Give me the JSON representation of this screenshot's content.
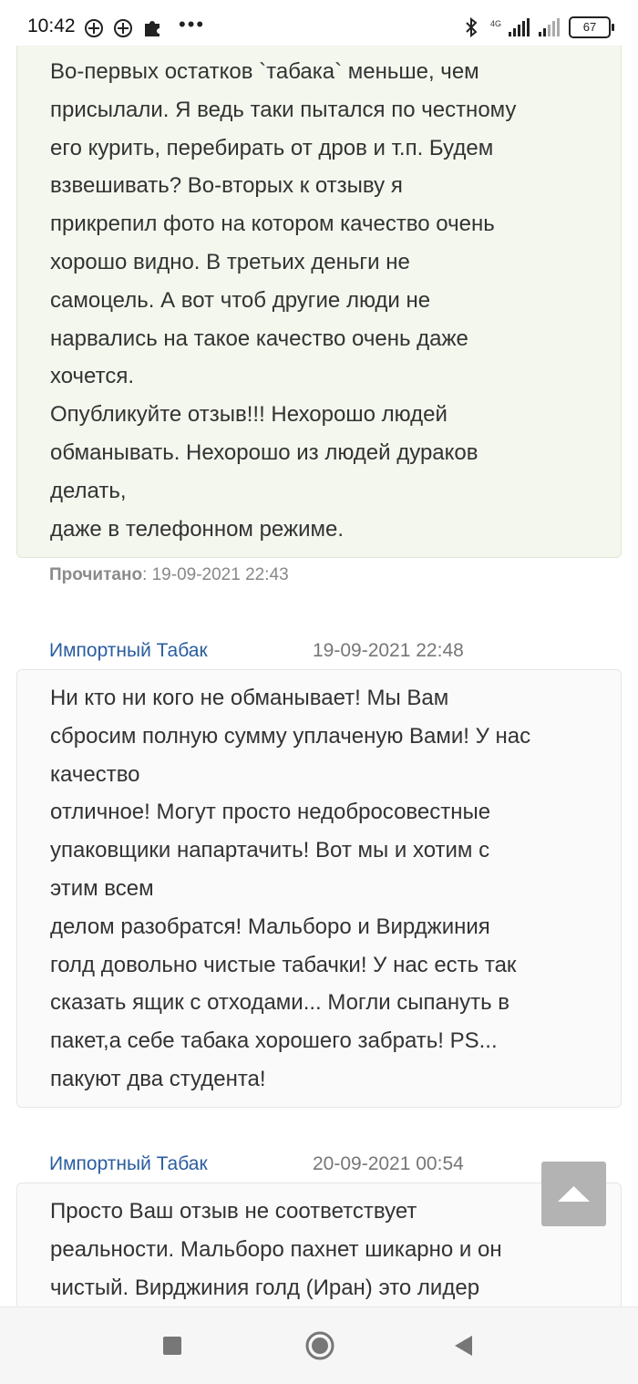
{
  "status_bar": {
    "time": "10:42",
    "network": "4G",
    "battery": "67",
    "icons": [
      "pinwheel-icon",
      "pinwheel-icon",
      "puzzle-icon",
      "more-dots-icon",
      "bluetooth-icon",
      "signal-icon",
      "signal-icon",
      "battery-icon"
    ]
  },
  "thread": {
    "user_message": {
      "lines": [
        "Во-первых остатков `табака` меньше, чем",
        "присылали. Я ведь таки пытался по честному",
        "его курить, перебирать от дров и т.п. Будем",
        "взвешивать? Во-вторых к отзыву я",
        "прикрепил фото на котором качество очень",
        "хорошо видно. В третьих деньги не",
        "самоцель. А вот чтоб другие люди не",
        "нарвались на такое качество очень даже",
        "хочется.",
        "Опубликуйте отзыв!!! Нехорошо людей",
        "обманывать. Нехорошо из людей дураков",
        "делать,",
        "даже в телефонном режиме."
      ],
      "read_label": "Прочитано",
      "read_time": ": 19-09-2021 22:43"
    },
    "replies": [
      {
        "author": "Импортный Табак",
        "date": "19-09-2021 22:48",
        "lines": [
          "Ни кто ни кого не обманывает! Мы Вам",
          "сбросим полную сумму уплаченую Вами! У нас",
          "качество",
          "отличное! Могут просто недобросовестные",
          "упаковщики напартачить! Вот мы и хотим с",
          "этим всем",
          "делом разобратся! Мальборо и Вирджиния",
          "голд довольно чистые табачки! У нас есть так",
          "сказать ящик с отходами... Могли сыпануть в",
          "пакет,а себе табака хорошего забрать! PS...",
          "пакуют два студента!"
        ]
      },
      {
        "author": "Импортный Табак",
        "date": "20-09-2021 00:54",
        "lines": [
          "Просто Ваш отзыв не соответствует",
          "реальности. Мальборо пахнет шикарно и он",
          "чистый. Вирджиния голд (Иран) это лидер"
        ]
      }
    ]
  },
  "controls": {
    "scroll_top": "triangle-up-icon",
    "nav": [
      "recent-apps-icon",
      "home-icon",
      "back-icon"
    ]
  },
  "colors": {
    "user_bubble": "#f4f7ee",
    "shop_bubble": "#fafafa",
    "author_link": "#2a5d9f",
    "scroll_button": "#b3b3b3"
  }
}
